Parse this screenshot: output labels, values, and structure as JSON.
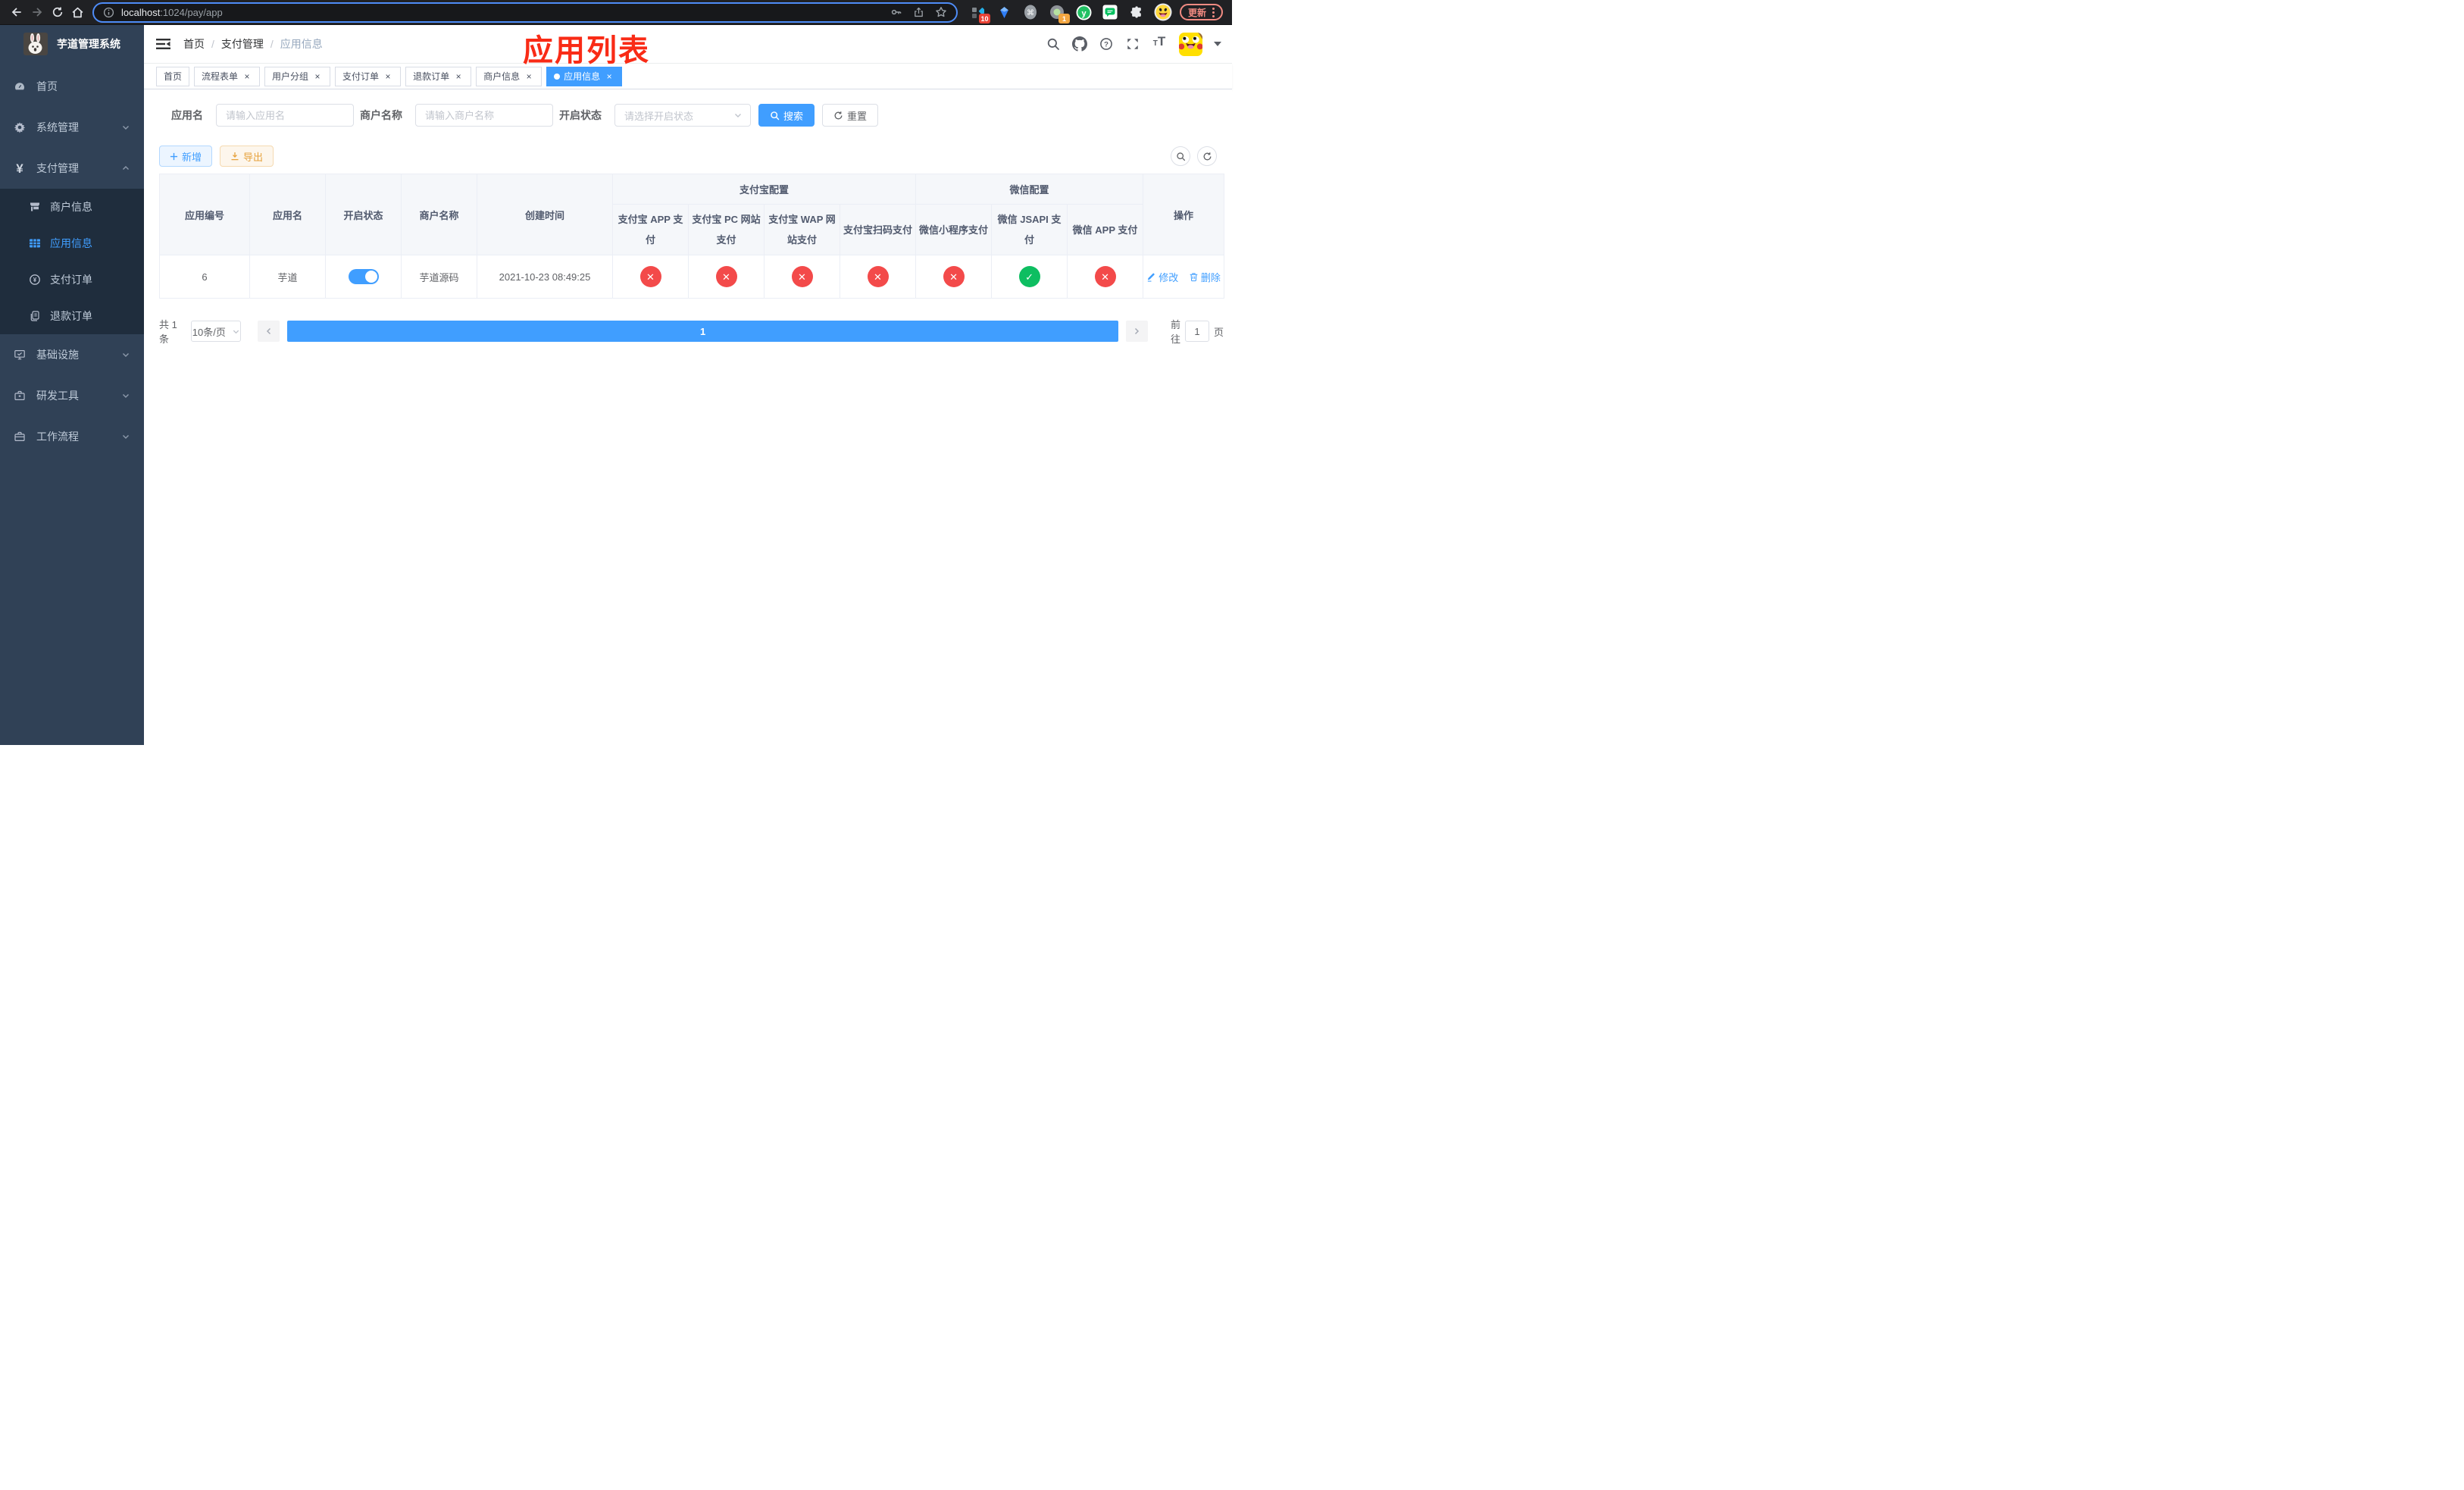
{
  "colors": {
    "primary": "#409eff",
    "success": "#0ebe61",
    "danger": "#f34a4a",
    "warning": "#e6a23c",
    "annotation": "#f92b16",
    "sidebar-bg": "#304156",
    "submenu-bg": "#1f2d3d",
    "update-pill": "#f28b82"
  },
  "browser": {
    "host": "localhost",
    "path": ":1024/pay/app",
    "update_label": "更新",
    "grid_ext_badge": "10",
    "avatar_ext_badge": "1"
  },
  "sidebar": {
    "logo_title": "芋道管理系统",
    "menu": [
      {
        "label": "首页",
        "icon": "dashboard-icon"
      },
      {
        "label": "系统管理",
        "icon": "gear-icon"
      },
      {
        "label": "支付管理",
        "icon": "yen-icon"
      },
      {
        "label": "商户信息",
        "icon": "shop-icon"
      },
      {
        "label": "应用信息",
        "icon": "grid-icon"
      },
      {
        "label": "支付订单",
        "icon": "pay-order-icon"
      },
      {
        "label": "退款订单",
        "icon": "refund-icon"
      },
      {
        "label": "基础设施",
        "icon": "monitor-icon"
      },
      {
        "label": "研发工具",
        "icon": "toolbox-icon"
      },
      {
        "label": "工作流程",
        "icon": "briefcase-icon"
      }
    ]
  },
  "topbar": {
    "breadcrumb": [
      "首页",
      "支付管理",
      "应用信息"
    ],
    "annotation": "应用列表"
  },
  "tags": [
    {
      "label": "首页"
    },
    {
      "label": "流程表单"
    },
    {
      "label": "用户分组"
    },
    {
      "label": "支付订单"
    },
    {
      "label": "退款订单"
    },
    {
      "label": "商户信息"
    },
    {
      "label": "应用信息"
    }
  ],
  "filters": {
    "app_name_label": "应用名",
    "app_name_placeholder": "请输入应用名",
    "merchant_label": "商户名称",
    "merchant_placeholder": "请输入商户名称",
    "status_label": "开启状态",
    "status_placeholder": "请选择开启状态",
    "search_label": "搜索",
    "reset_label": "重置"
  },
  "actions": {
    "add_label": "新增",
    "export_label": "导出"
  },
  "table": {
    "headers": {
      "app_id": "应用编号",
      "app_name": "应用名",
      "status": "开启状态",
      "merchant": "商户名称",
      "created": "创建时间",
      "alipay_group": "支付宝配置",
      "wechat_group": "微信配置",
      "operation": "操作",
      "pay_columns": [
        "支付宝 APP 支付",
        "支付宝 PC 网站支付",
        "支付宝 WAP 网站支付",
        "支付宝扫码支付",
        "微信小程序支付",
        "微信 JSAPI 支付",
        "微信 APP 支付"
      ]
    },
    "row": {
      "app_id": "6",
      "app_name": "芋道",
      "status_on": true,
      "merchant": "芋道源码",
      "created": "2021-10-23 08:49:25",
      "pay_status": [
        false,
        false,
        false,
        false,
        false,
        true,
        false
      ],
      "edit_label": "修改",
      "delete_label": "删除"
    }
  },
  "pagination": {
    "total": "共 1 条",
    "page_size": "10条/页",
    "page": "1",
    "goto_label": "前往",
    "goto_value": "1",
    "page_suffix": "页"
  }
}
